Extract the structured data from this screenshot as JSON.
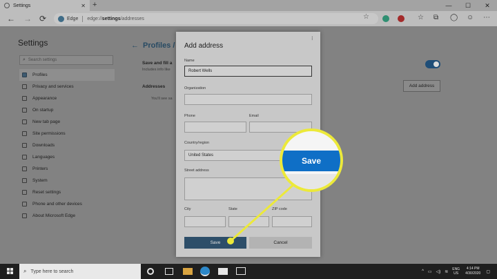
{
  "browser": {
    "tab_title": "Settings",
    "tab_close": "✕",
    "new_tab": "+",
    "window_controls": [
      "—",
      "☐",
      "✕"
    ],
    "back": "←",
    "forward": "→",
    "refresh": "⟳",
    "edge_label": "Edge",
    "url_bold": "settings",
    "url_prefix": "edge://",
    "url_suffix": "/addresses"
  },
  "settings": {
    "title": "Settings",
    "search_placeholder": "Search settings",
    "menu": [
      {
        "label": "Profiles",
        "active": true
      },
      {
        "label": "Privacy and services"
      },
      {
        "label": "Appearance"
      },
      {
        "label": "On startup"
      },
      {
        "label": "New tab page"
      },
      {
        "label": "Site permissions"
      },
      {
        "label": "Downloads"
      },
      {
        "label": "Languages"
      },
      {
        "label": "Printers"
      },
      {
        "label": "System"
      },
      {
        "label": "Reset settings"
      },
      {
        "label": "Phone and other devices"
      },
      {
        "label": "About Microsoft Edge"
      }
    ],
    "breadcrumb": "Profiles / A",
    "save_fill_label": "Save and fill a",
    "save_fill_sub": "Includes info like",
    "addresses_heading": "Addresses",
    "addresses_empty": "You'll see sa",
    "add_address_button": "Add address"
  },
  "dialog": {
    "title": "Add address",
    "more": "⁝",
    "labels": {
      "name": "Name",
      "organization": "Organization",
      "phone": "Phone",
      "email": "Email",
      "country": "Country/region",
      "street": "Street address",
      "city": "City",
      "state": "State",
      "zip": "ZIP code"
    },
    "values": {
      "name": "Robert Wells",
      "organization": "",
      "phone": "",
      "email": "",
      "country": "United States",
      "street": "",
      "city": "",
      "state": "",
      "zip": ""
    },
    "save_button": "Save",
    "cancel_button": "Cancel"
  },
  "callout": {
    "label": "Save",
    "highlight_color": "#ece93a",
    "button_color": "#0f6fc6"
  },
  "taskbar": {
    "search_placeholder": "Type here to search",
    "lang_top": "ENG",
    "lang_bottom": "US",
    "time": "4:14 PM",
    "date": "4/30/2020"
  }
}
